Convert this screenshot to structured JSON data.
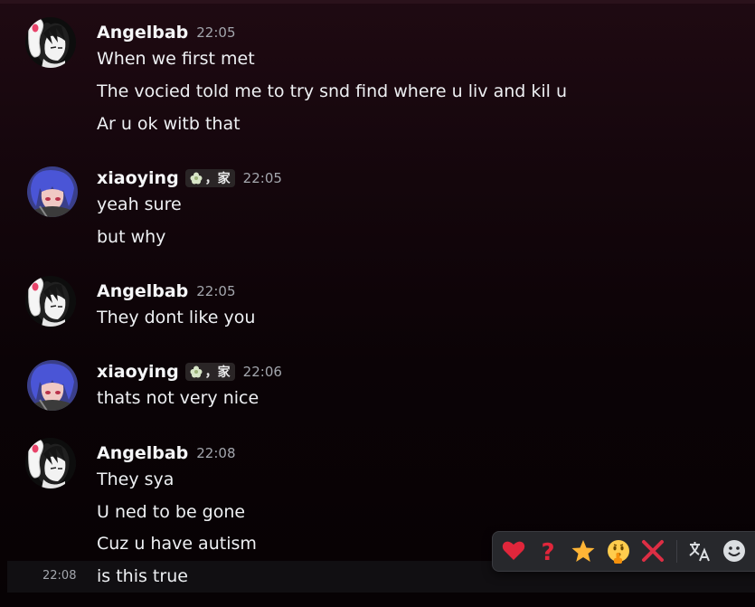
{
  "messages": [
    {
      "author": "Angelbab",
      "time": "22:05",
      "avatar": "ghost-avatar",
      "lines": [
        "When we first met",
        "The vocied told me to try snd find where u liv and kil u",
        "Ar u ok witb that"
      ]
    },
    {
      "author": "xiaoying",
      "tag": "，家",
      "time": "22:05",
      "avatar": "blue-hair-avatar",
      "lines": [
        "yeah sure",
        "but why"
      ]
    },
    {
      "author": "Angelbab",
      "time": "22:05",
      "avatar": "ghost-avatar",
      "lines": [
        "They dont like you"
      ]
    },
    {
      "author": "xiaoying",
      "tag": "，家",
      "time": "22:06",
      "avatar": "blue-hair-avatar",
      "lines": [
        "thats not very nice"
      ]
    },
    {
      "author": "Angelbab",
      "time": "22:08",
      "avatar": "ghost-avatar",
      "lines": [
        "They sya",
        "U ned to be gone",
        "Cuz u have autism",
        "is this true"
      ]
    }
  ],
  "hovered_message": {
    "time": "22:08"
  },
  "toolbar": {
    "reactions": [
      "heart",
      "question-mark",
      "star",
      "shushing-face",
      "cross-mark"
    ],
    "actions": [
      "translate",
      "add-reaction"
    ]
  },
  "colors": {
    "background_top": "#1f0a12",
    "background_bottom": "#070204",
    "toolbar": "#27282c"
  }
}
